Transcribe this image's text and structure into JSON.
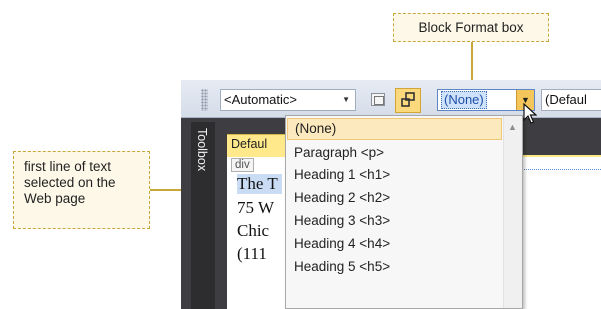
{
  "callouts": {
    "block_format": "Block Format box",
    "first_line": [
      "first line of text",
      "selected on the",
      "Web page"
    ]
  },
  "toolbar": {
    "style_combo": "<Automatic>",
    "block_format_value": "(None)",
    "font_combo": "(Defaul"
  },
  "side_panel": {
    "toolbox_label": "Toolbox"
  },
  "document": {
    "tab_label": "Defaul",
    "div_tag": "div",
    "lines": [
      "The T",
      "75 W",
      "Chic",
      "(111"
    ]
  },
  "dropdown": {
    "options": [
      "(None)",
      "Paragraph <p>",
      "Heading 1 <h1>",
      "Heading 2 <h2>",
      "Heading 3 <h3>",
      "Heading 4 <h4>",
      "Heading 5 <h5>"
    ],
    "selected": "(None)"
  },
  "colors": {
    "callout_fill": "#fdf8e8",
    "callout_border": "#c9a63a",
    "selection": "#fce9bd",
    "toolbar": "#dfe6f0",
    "document_tab": "#ffe98a"
  }
}
